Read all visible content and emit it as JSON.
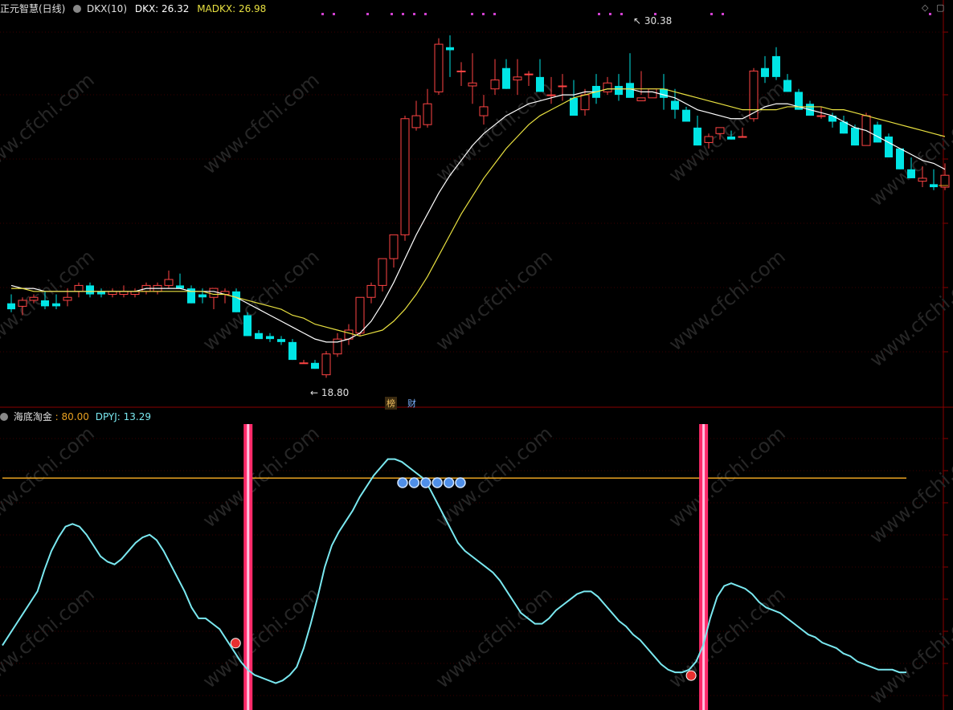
{
  "top_panel": {
    "title": "正元智慧(日线)",
    "indicator_name": "DKX(10)",
    "dkx_label": "DKX: 26.32",
    "madkx_label": "MADKX: 26.98",
    "high_mark": "30.38",
    "low_mark": "18.80",
    "badge_bang": "榜",
    "badge_cai": "财"
  },
  "bottom_panel": {
    "title": "海底淘金",
    "level_label": ": 80.00",
    "dpyj_label": "DPYJ: 13.29"
  },
  "watermark": "www.cfchi.com",
  "colors": {
    "bg": "#000000",
    "up": "#ff4444",
    "down": "#00e5e5",
    "dkx": "#ffffff",
    "madkx": "#e8e040",
    "dpyj": "#7ae8f0",
    "level": "#e8a020",
    "signal": "#ff2a6a",
    "panel_border": "#8a0000"
  },
  "chart_data": [
    {
      "type": "candlestick",
      "title": "DKX(10)",
      "series_names": [
        "DKX",
        "MADKX"
      ],
      "last_values": {
        "DKX": 26.32,
        "MADKX": 26.98
      },
      "annotations": [
        {
          "text": "30.38",
          "kind": "high"
        },
        {
          "text": "18.80",
          "kind": "low"
        }
      ],
      "y_range": [
        18.0,
        31.0
      ],
      "candles": [
        [
          21.3,
          21.6,
          21.0,
          21.1
        ],
        [
          21.2,
          21.5,
          20.9,
          21.4
        ],
        [
          21.4,
          21.6,
          21.3,
          21.5
        ],
        [
          21.4,
          21.7,
          21.1,
          21.2
        ],
        [
          21.3,
          21.6,
          21.1,
          21.2
        ],
        [
          21.4,
          21.8,
          21.2,
          21.5
        ],
        [
          21.7,
          22.0,
          21.5,
          21.9
        ],
        [
          21.9,
          22.0,
          21.5,
          21.6
        ],
        [
          21.7,
          21.8,
          21.5,
          21.6
        ],
        [
          21.6,
          21.8,
          21.5,
          21.7
        ],
        [
          21.6,
          21.9,
          21.5,
          21.7
        ],
        [
          21.6,
          21.8,
          21.5,
          21.7
        ],
        [
          21.7,
          22.0,
          21.6,
          21.9
        ],
        [
          21.7,
          22.0,
          21.6,
          21.9
        ],
        [
          21.9,
          22.4,
          21.8,
          22.1
        ],
        [
          21.9,
          22.3,
          21.8,
          21.8
        ],
        [
          21.8,
          21.9,
          21.3,
          21.3
        ],
        [
          21.6,
          21.8,
          21.3,
          21.5
        ],
        [
          21.5,
          21.8,
          21.1,
          21.8
        ],
        [
          21.6,
          21.8,
          21.3,
          21.7
        ],
        [
          21.7,
          21.8,
          21.0,
          21.0
        ],
        [
          20.9,
          21.0,
          20.2,
          20.2
        ],
        [
          20.3,
          20.4,
          20.1,
          20.1
        ],
        [
          20.2,
          20.3,
          20.0,
          20.1
        ],
        [
          20.1,
          20.2,
          19.9,
          20.0
        ],
        [
          20.0,
          20.1,
          19.4,
          19.4
        ],
        [
          19.3,
          19.4,
          19.3,
          19.3
        ],
        [
          19.3,
          19.4,
          19.1,
          19.1
        ],
        [
          18.9,
          19.7,
          18.8,
          19.6
        ],
        [
          19.6,
          20.3,
          19.5,
          20.1
        ],
        [
          20.1,
          20.6,
          19.9,
          20.4
        ],
        [
          20.3,
          21.5,
          20.2,
          21.5
        ],
        [
          21.5,
          22.0,
          21.3,
          21.9
        ],
        [
          21.9,
          22.8,
          21.7,
          22.8
        ],
        [
          22.8,
          23.6,
          22.5,
          23.6
        ],
        [
          23.6,
          27.6,
          23.4,
          27.5
        ],
        [
          27.2,
          28.1,
          27.1,
          27.6
        ],
        [
          27.3,
          28.5,
          27.2,
          28.0
        ],
        [
          28.4,
          30.2,
          28.3,
          30.0
        ],
        [
          29.9,
          30.3,
          28.9,
          29.8
        ],
        [
          29.1,
          29.4,
          28.6,
          29.1
        ],
        [
          28.6,
          29.7,
          28.0,
          28.7
        ],
        [
          27.6,
          28.3,
          27.3,
          27.9
        ],
        [
          28.5,
          29.5,
          28.3,
          28.8
        ],
        [
          29.2,
          29.5,
          28.5,
          28.5
        ],
        [
          28.8,
          29.5,
          28.3,
          28.9
        ],
        [
          29.0,
          29.1,
          28.6,
          29.0
        ],
        [
          28.9,
          29.5,
          28.4,
          28.4
        ],
        [
          28.3,
          28.9,
          28.0,
          28.3
        ],
        [
          28.6,
          29.0,
          28.1,
          28.6
        ],
        [
          28.2,
          28.8,
          27.6,
          27.6
        ],
        [
          27.8,
          28.5,
          27.6,
          28.3
        ],
        [
          28.6,
          29.0,
          28.0,
          28.2
        ],
        [
          28.4,
          28.9,
          28.3,
          28.7
        ],
        [
          28.6,
          29.0,
          28.1,
          28.3
        ],
        [
          28.7,
          29.7,
          28.4,
          28.2
        ],
        [
          28.1,
          29.1,
          28.3,
          28.2
        ],
        [
          28.2,
          28.3,
          28.5,
          28.5
        ],
        [
          28.5,
          29.0,
          27.8,
          28.2
        ],
        [
          28.1,
          28.5,
          27.5,
          27.8
        ],
        [
          27.8,
          27.9,
          27.4,
          27.4
        ],
        [
          27.2,
          27.6,
          26.6,
          26.6
        ],
        [
          26.7,
          27.0,
          26.5,
          26.9
        ],
        [
          27.0,
          27.2,
          26.8,
          27.2
        ],
        [
          26.9,
          27.1,
          26.8,
          26.8
        ],
        [
          26.9,
          27.2,
          26.9,
          26.9
        ],
        [
          27.5,
          29.2,
          27.4,
          29.1
        ],
        [
          29.2,
          29.6,
          28.7,
          28.9
        ],
        [
          29.6,
          29.9,
          28.8,
          28.9
        ],
        [
          28.8,
          29.0,
          28.4,
          28.4
        ],
        [
          28.4,
          28.5,
          27.8,
          27.8
        ],
        [
          28.0,
          28.1,
          27.6,
          27.6
        ],
        [
          27.6,
          27.9,
          27.5,
          27.6
        ],
        [
          27.6,
          27.7,
          27.2,
          27.4
        ],
        [
          27.4,
          27.6,
          27.0,
          27.0
        ],
        [
          27.2,
          27.3,
          26.6,
          26.6
        ],
        [
          26.6,
          27.7,
          26.6,
          27.6
        ],
        [
          27.3,
          27.4,
          26.7,
          26.7
        ],
        [
          26.9,
          27.0,
          26.2,
          26.2
        ],
        [
          26.5,
          26.5,
          25.8,
          25.8
        ],
        [
          25.8,
          26.2,
          25.5,
          25.5
        ],
        [
          25.4,
          25.9,
          25.2,
          25.5
        ],
        [
          25.3,
          25.8,
          25.1,
          25.2
        ],
        [
          25.2,
          26.0,
          25.1,
          25.6
        ]
      ],
      "series": [
        {
          "name": "DKX",
          "values": [
            21.9,
            21.8,
            21.8,
            21.7,
            21.7,
            21.7,
            21.7,
            21.7,
            21.7,
            21.7,
            21.7,
            21.7,
            21.8,
            21.8,
            21.8,
            21.8,
            21.7,
            21.7,
            21.7,
            21.6,
            21.5,
            21.3,
            21.1,
            20.9,
            20.7,
            20.5,
            20.3,
            20.1,
            20.0,
            20.0,
            20.1,
            20.3,
            20.7,
            21.3,
            22.0,
            22.8,
            23.6,
            24.3,
            25.0,
            25.6,
            26.1,
            26.6,
            27.0,
            27.3,
            27.6,
            27.8,
            28.0,
            28.1,
            28.2,
            28.3,
            28.3,
            28.4,
            28.4,
            28.5,
            28.5,
            28.5,
            28.4,
            28.4,
            28.3,
            28.2,
            28.0,
            27.8,
            27.7,
            27.6,
            27.5,
            27.5,
            27.7,
            27.9,
            28.0,
            28.0,
            27.9,
            27.8,
            27.7,
            27.6,
            27.4,
            27.2,
            27.1,
            26.9,
            26.7,
            26.5,
            26.3,
            26.1,
            26.0,
            25.8
          ]
        },
        {
          "name": "MADKX",
          "values": [
            21.8,
            21.8,
            21.7,
            21.7,
            21.7,
            21.7,
            21.7,
            21.7,
            21.7,
            21.7,
            21.7,
            21.7,
            21.7,
            21.7,
            21.7,
            21.7,
            21.7,
            21.7,
            21.6,
            21.6,
            21.5,
            21.4,
            21.3,
            21.2,
            21.1,
            20.9,
            20.8,
            20.6,
            20.5,
            20.4,
            20.3,
            20.2,
            20.3,
            20.4,
            20.7,
            21.1,
            21.6,
            22.2,
            22.9,
            23.6,
            24.3,
            24.9,
            25.5,
            26.0,
            26.5,
            26.9,
            27.3,
            27.6,
            27.8,
            28.0,
            28.2,
            28.3,
            28.4,
            28.5,
            28.5,
            28.5,
            28.5,
            28.5,
            28.5,
            28.4,
            28.3,
            28.2,
            28.1,
            28.0,
            27.9,
            27.8,
            27.8,
            27.8,
            27.8,
            27.9,
            27.9,
            27.9,
            27.9,
            27.8,
            27.8,
            27.7,
            27.6,
            27.5,
            27.4,
            27.3,
            27.2,
            27.1,
            27.0,
            26.9
          ]
        }
      ]
    },
    {
      "type": "line",
      "title": "海底淘金",
      "y_range": [
        0,
        100
      ],
      "series": [
        {
          "name": "DPYJ",
          "values": [
            18,
            22,
            26,
            30,
            34,
            38,
            46,
            53,
            58,
            62,
            63,
            62,
            59,
            55,
            51,
            49,
            48,
            50,
            53,
            56,
            58,
            59,
            57,
            53,
            48,
            43,
            38,
            32,
            28,
            28,
            26,
            24,
            20,
            16,
            12,
            9,
            7,
            6,
            5,
            4,
            5,
            7,
            10,
            17,
            26,
            36,
            47,
            55,
            60,
            64,
            68,
            73,
            77,
            81,
            84,
            87,
            87,
            86,
            84,
            82,
            80,
            76,
            71,
            66,
            61,
            56,
            53,
            51,
            49,
            47,
            45,
            42,
            38,
            34,
            30,
            28,
            26,
            26,
            28,
            31,
            33,
            35,
            37,
            38,
            38,
            36,
            33,
            30,
            27,
            25,
            22,
            20,
            17,
            14,
            11,
            9,
            8,
            8,
            9,
            12,
            18,
            28,
            36,
            40,
            41,
            40,
            39,
            37,
            34,
            32,
            31,
            30,
            28,
            26,
            24,
            22,
            21,
            19,
            18,
            17,
            15,
            14,
            12,
            11,
            10,
            9,
            9,
            9,
            8,
            8
          ]
        },
        {
          "name": "level",
          "values": [
            80
          ]
        }
      ],
      "signals": [
        {
          "kind": "bottom",
          "x_index": 35
        },
        {
          "kind": "bottom",
          "x_index": 100
        }
      ]
    }
  ]
}
